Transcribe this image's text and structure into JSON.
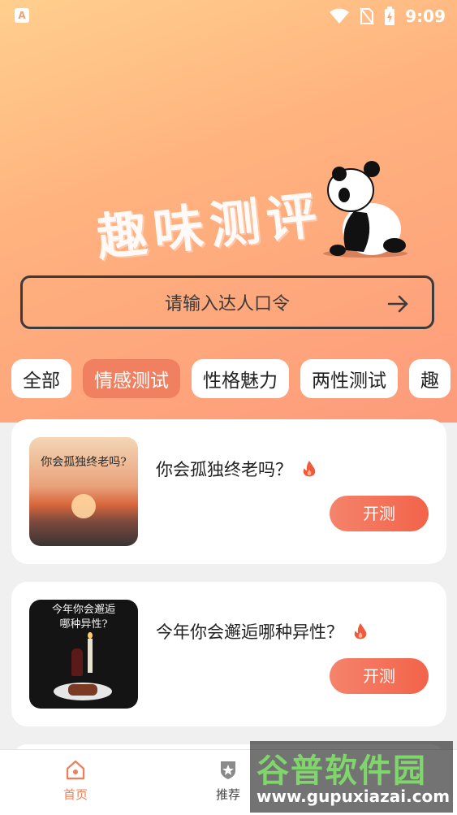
{
  "status": {
    "time": "9:09",
    "app_icon_letter": "A"
  },
  "hero": {
    "title": "趣味测评"
  },
  "search": {
    "placeholder": "请输入达人口令"
  },
  "tabs": [
    {
      "label": "全部",
      "active": false
    },
    {
      "label": "情感测试",
      "active": true
    },
    {
      "label": "性格魅力",
      "active": false
    },
    {
      "label": "两性测试",
      "active": false
    },
    {
      "label": "趣",
      "active": false
    }
  ],
  "cards": [
    {
      "title": "你会孤独终老吗？",
      "thumb_text": "你会孤独终老吗?",
      "button": "开测"
    },
    {
      "title": "今年你会邂逅哪种异性？",
      "thumb_text_1": "今年你会邂逅",
      "thumb_text_2": "哪种异性?",
      "button": "开测"
    }
  ],
  "nav": {
    "home": "首页",
    "recommend": "推荐"
  },
  "watermark": {
    "big": "谷普软件园",
    "small": "www.gupuxiazai.com"
  },
  "colors": {
    "accent": "#f0805f",
    "nav_active": "#ef7d5a"
  }
}
